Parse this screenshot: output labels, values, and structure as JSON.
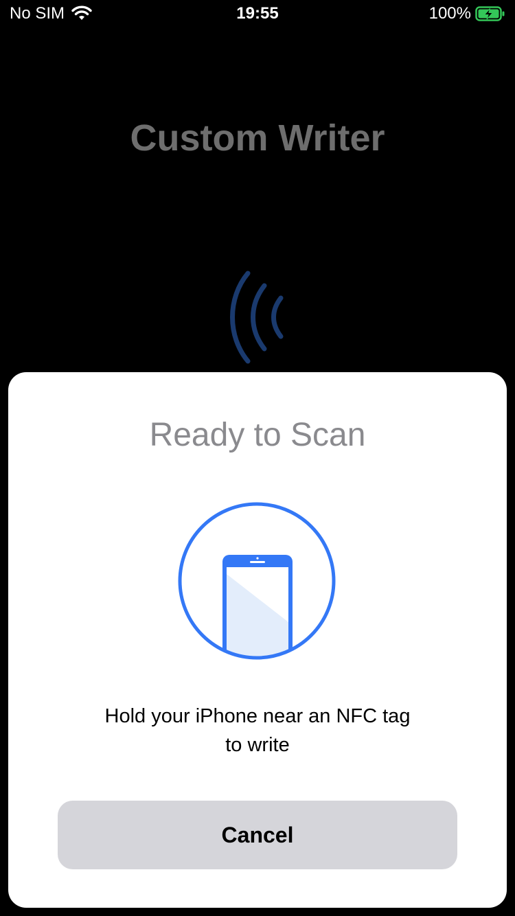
{
  "status_bar": {
    "carrier": "No SIM",
    "time": "19:55",
    "battery": "100%",
    "wifi_icon": "wifi-icon",
    "battery_icon": "battery-charging-icon"
  },
  "app": {
    "title": "Custom Writer",
    "nfc_icon": "nfc-waves-icon"
  },
  "sheet": {
    "title": "Ready to Scan",
    "illustration_icon": "phone-scan-icon",
    "message_line1": "Hold your iPhone near an NFC tag",
    "message_line2": "to write",
    "cancel_label": "Cancel"
  },
  "colors": {
    "accent": "#3478f6",
    "nfc_waves": "#1a3a6e",
    "sheet_title": "#8a8a8e",
    "button_bg": "#d5d5da"
  }
}
